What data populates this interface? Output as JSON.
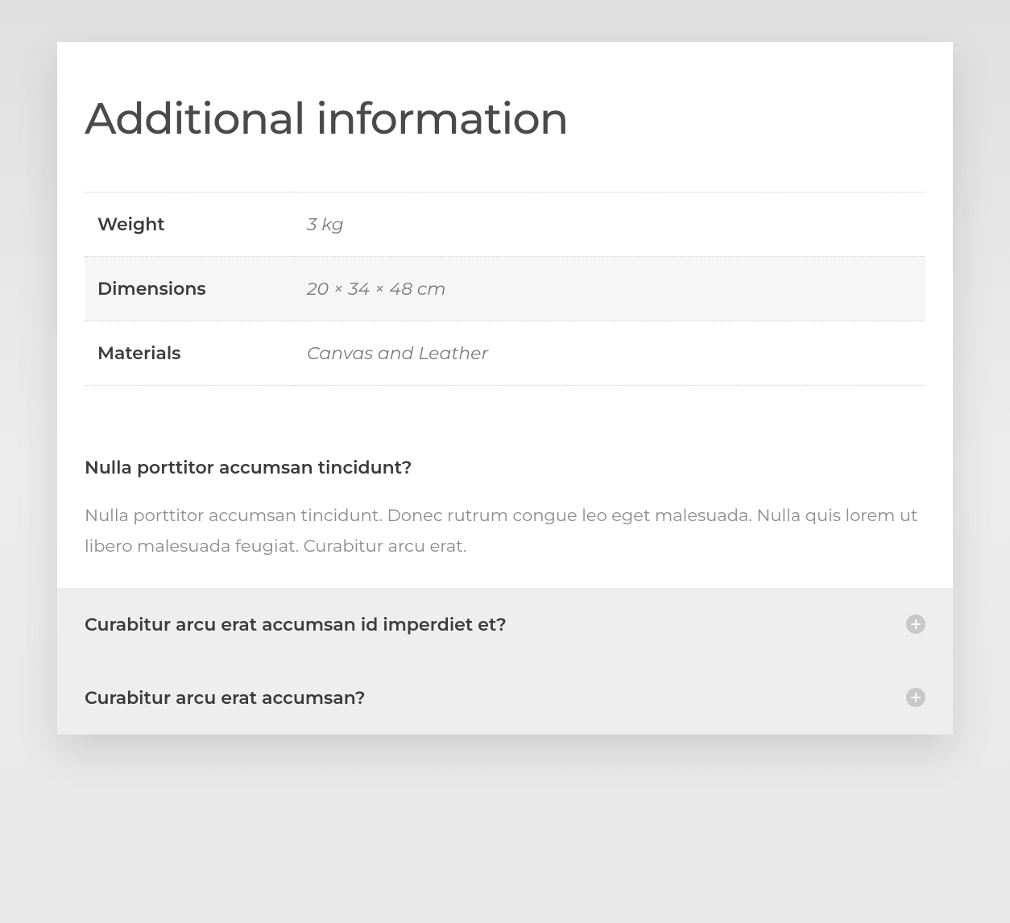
{
  "title": "Additional information",
  "attributes": [
    {
      "label": "Weight",
      "value": "3 kg"
    },
    {
      "label": "Dimensions",
      "value": "20 × 34 × 48 cm"
    },
    {
      "label": "Materials",
      "value": "Canvas and Leather"
    }
  ],
  "accordion": [
    {
      "question": "Nulla porttitor accumsan tincidunt?",
      "answer": "Nulla porttitor accumsan tincidunt. Donec rutrum congue leo eget malesuada. Nulla quis lorem ut libero malesuada feugiat. Curabitur arcu erat.",
      "open": true
    },
    {
      "question": "Curabitur arcu erat accumsan id imperdiet et?",
      "answer": "",
      "open": false
    },
    {
      "question": "Curabitur arcu erat accumsan?",
      "answer": "",
      "open": false
    }
  ]
}
